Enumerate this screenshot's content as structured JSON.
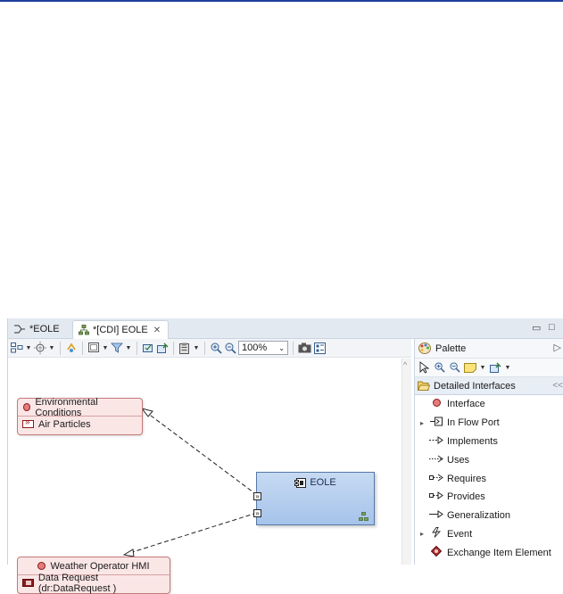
{
  "tabs": [
    {
      "label": "*EOLE",
      "icon": "sequence-icon",
      "closable": false
    },
    {
      "label": "*[CDI] EOLE",
      "icon": "diagram-icon",
      "closable": true,
      "close": "✕"
    }
  ],
  "window_controls": {
    "minimize": "▭",
    "maximize": "□"
  },
  "toolbar": {
    "zoom": "100%"
  },
  "nodes": {
    "environmental": {
      "title": "Environmental Conditions",
      "item": "Air Particles"
    },
    "weather": {
      "title": "Weather Operator HMI",
      "item": "Data Request (dr:DataRequest )"
    },
    "eole": {
      "title": "EOLE"
    }
  },
  "palette": {
    "title": "Palette",
    "drawer": "Detailed Interfaces",
    "items": [
      {
        "label": "Interface",
        "icon": "interface-icon",
        "expandable": false
      },
      {
        "label": "In Flow Port",
        "icon": "in-flow-port-icon",
        "expandable": true
      },
      {
        "label": "Implements",
        "icon": "implements-icon",
        "expandable": false
      },
      {
        "label": "Uses",
        "icon": "uses-icon",
        "expandable": false
      },
      {
        "label": "Requires",
        "icon": "requires-icon",
        "expandable": false
      },
      {
        "label": "Provides",
        "icon": "provides-icon",
        "expandable": false
      },
      {
        "label": "Generalization",
        "icon": "generalization-icon",
        "expandable": false
      },
      {
        "label": "Event",
        "icon": "event-icon",
        "expandable": true
      },
      {
        "label": "Exchange Item Element",
        "icon": "exchange-item-element-icon",
        "expandable": false
      }
    ]
  },
  "colors": {
    "interface_fill": "#fbe6e6",
    "component_fill": "#b7cfee",
    "accent": "#1f3f9e"
  }
}
